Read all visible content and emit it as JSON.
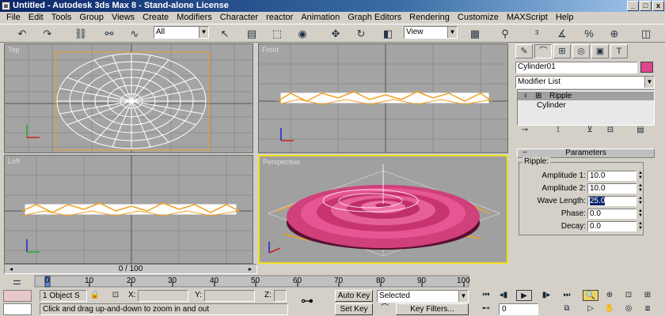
{
  "window": {
    "title": "Untitled    - Autodesk 3ds Max 8   - Stand-alone License",
    "min": "_",
    "max": "□",
    "close": "x"
  },
  "menu": [
    "File",
    "Edit",
    "Tools",
    "Group",
    "Views",
    "Create",
    "Modifiers",
    "Character",
    "reactor",
    "Animation",
    "Graph Editors",
    "Rendering",
    "Customize",
    "MAXScript",
    "Help"
  ],
  "toolbar": {
    "selection_filter": "All",
    "ref_coord": "View",
    "icons": [
      "undo-icon",
      "redo-icon",
      "select-link-icon",
      "unlink-icon",
      "bind-space-warp-icon",
      "select-icon",
      "select-by-name-icon",
      "rect-region-icon",
      "window-crossing-icon",
      "select-move-icon",
      "select-rotate-icon",
      "select-scale-icon",
      "pivot-icon",
      "mirror-icon",
      "align-icon",
      "snap-icon",
      "angle-snap-icon",
      "percent-snap-icon",
      "spinner-snap-icon",
      "render-icon"
    ]
  },
  "viewports": [
    {
      "name": "Top"
    },
    {
      "name": "Front"
    },
    {
      "name": "Left"
    },
    {
      "name": "Perspective"
    }
  ],
  "command_panel": {
    "object_name": "Cylinder01",
    "object_color": "#e0448c",
    "modifier_list": "Modifier List",
    "stack": [
      "Ripple",
      "Cylinder"
    ],
    "rollout_title": "Parameters",
    "group_label": "Ripple:",
    "params": [
      {
        "label": "Amplitude 1:",
        "value": "10.0"
      },
      {
        "label": "Amplitude 2:",
        "value": "10.0"
      },
      {
        "label": "Wave Length:",
        "value": "25.0"
      },
      {
        "label": "Phase:",
        "value": "0.0"
      },
      {
        "label": "Decay:",
        "value": "0.0"
      }
    ]
  },
  "timeline": {
    "slider_label": "0 / 100",
    "ticks": [
      "0",
      "10",
      "20",
      "30",
      "40",
      "50",
      "60",
      "70",
      "80",
      "90",
      "100"
    ]
  },
  "status": {
    "objects": "1 Object S",
    "x_label": "X:",
    "y_label": "Y:",
    "z_label": "Z:",
    "prompt": "Click and drag up-and-down to zoom in and out",
    "auto_key": "Auto Key",
    "set_key": "Set Key",
    "selected": "Selected",
    "key_filters": "Key Filters...",
    "frame": "0"
  },
  "colors": {
    "accent": "#e0448c",
    "active_viewport": "#f0e020",
    "wire": "#ffffff",
    "selection": "#f0a020"
  }
}
